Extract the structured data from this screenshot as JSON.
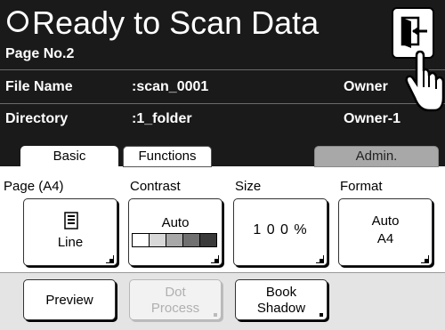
{
  "header": {
    "title": "Ready to Scan Data",
    "page_no": "Page No.2",
    "file_name_label": "File Name",
    "file_name_value": ":scan_0001",
    "owner_label": "Owner",
    "directory_label": "Directory",
    "directory_value": ":1_folder",
    "owner_value": "Owner-1"
  },
  "tabs": [
    {
      "label": "Basic",
      "selected": true
    },
    {
      "label": "Functions",
      "selected": false
    },
    {
      "label": "Admin.",
      "selected": false
    }
  ],
  "settings": {
    "page": {
      "label": "Page (A4)",
      "value": "Line"
    },
    "contrast": {
      "label": "Contrast",
      "value": "Auto"
    },
    "size": {
      "label": "Size",
      "value": "1 0 0 %"
    },
    "format": {
      "label": "Format",
      "value_line1": "Auto",
      "value_line2": "A4"
    }
  },
  "bottom_buttons": {
    "preview": "Preview",
    "dot_process_line1": "Dot",
    "dot_process_line2": "Process",
    "book_shadow_line1": "Book",
    "book_shadow_line2": "Shadow"
  },
  "colors": {
    "header_bg": "#1a1a1a",
    "admin_tab_bg": "#a8a8a8",
    "bottom_bar_bg": "#e4e4e4",
    "disabled_text": "#b0b0b0"
  },
  "icons": [
    "status-circle-icon",
    "exit-door-icon",
    "pointing-hand-icon",
    "document-icon",
    "contrast-scale-icon"
  ]
}
